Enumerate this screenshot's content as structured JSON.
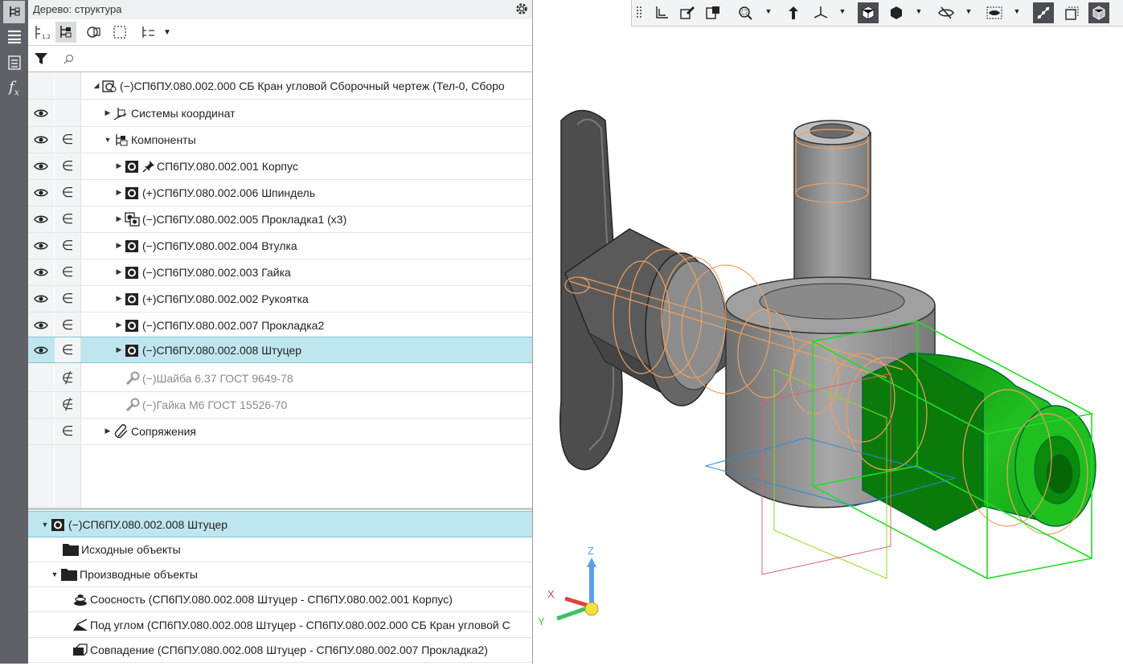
{
  "panel": {
    "title": "Дерево: структура",
    "search_placeholder": ""
  },
  "tree": {
    "rows": [
      {
        "label": "СП6ПУ.080.002.000 СБ Кран угловой Сборочный чертеж (Тел-0, Сборо",
        "prefix": "(−)"
      },
      {
        "label": "Системы координат",
        "prefix": ""
      },
      {
        "label": "Компоненты",
        "prefix": ""
      },
      {
        "label": "СП6ПУ.080.002.001 Корпус",
        "prefix": ""
      },
      {
        "label": "СП6ПУ.080.002.006 Шпиндель",
        "prefix": "(+)"
      },
      {
        "label": "СП6ПУ.080.002.005 Прокладка1 (х3)",
        "prefix": "(−)"
      },
      {
        "label": "СП6ПУ.080.002.004 Втулка",
        "prefix": "(−)"
      },
      {
        "label": "СП6ПУ.080.002.003 Гайка",
        "prefix": "(−)"
      },
      {
        "label": "СП6ПУ.080.002.002 Рукоятка",
        "prefix": "(+)"
      },
      {
        "label": "СП6ПУ.080.002.007 Прокладка2",
        "prefix": "(−)"
      },
      {
        "label": "СП6ПУ.080.002.008 Штуцер",
        "prefix": "(−)"
      },
      {
        "label": "Шайба 6.37 ГОСТ 9649-78",
        "prefix": "(−)"
      },
      {
        "label": "Гайка М6 ГОСТ 15526-70",
        "prefix": "(−)"
      },
      {
        "label": "Сопряжения",
        "prefix": ""
      }
    ]
  },
  "lower": {
    "rows": [
      {
        "label": "СП6ПУ.080.002.008 Штуцер",
        "prefix": "(−)"
      },
      {
        "label": "Исходные объекты"
      },
      {
        "label": "Производные объекты"
      },
      {
        "label": "Соосность (СП6ПУ.080.002.008 Штуцер  -  СП6ПУ.080.002.001 Корпус)"
      },
      {
        "label": "Под углом (СП6ПУ.080.002.008 Штуцер  -  СП6ПУ.080.002.000 СБ Кран угловой С"
      },
      {
        "label": "Совпадение (СП6ПУ.080.002.008 Штуцер  -  СП6ПУ.080.002.007 Прокладка2)"
      }
    ]
  },
  "axes": {
    "x": "X",
    "y": "Y",
    "z": "Z"
  },
  "colors": {
    "selection": "#bfe6ef",
    "selected_part": "#1fb31f",
    "bbox": "#22dd22",
    "edges_hidden": "#f0a060"
  }
}
